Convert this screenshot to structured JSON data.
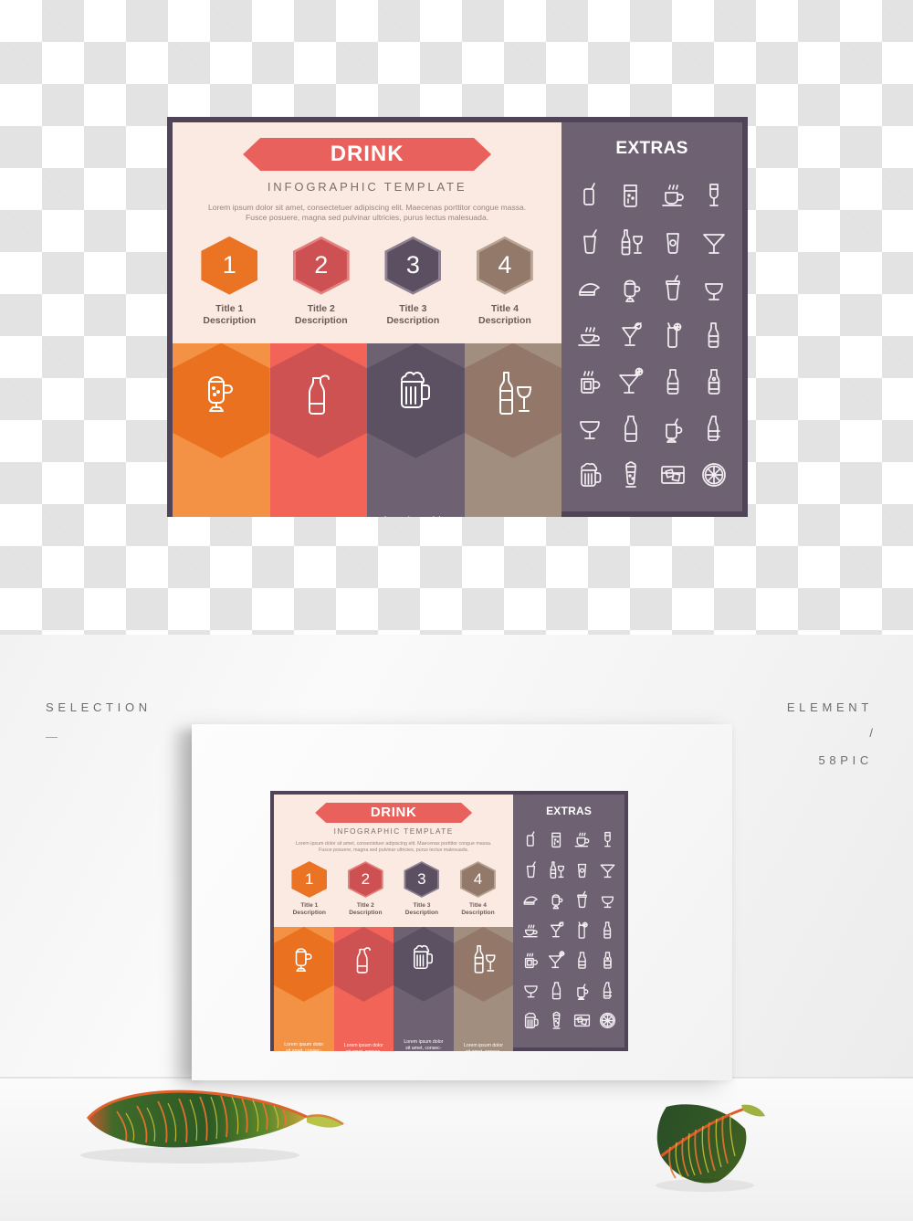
{
  "artwork": {
    "banner_title": "DRINK",
    "subtitle": "INFOGRAPHIC TEMPLATE",
    "lead": "Lorem ipsum dolor sit amet, consectetuer adipiscing elit. Maecenas porttitor congue massa. Fusce posuere, magna sed pulvinar ultricies, purus lectus malesuada.",
    "steps": [
      {
        "number": "1",
        "title": "Title 1",
        "description": "Description",
        "color": "#ea7324",
        "column_color": "#f39244",
        "hex_color": "#e9711f",
        "icon": "irish-coffee-mug-icon"
      },
      {
        "number": "2",
        "title": "Title 2",
        "description": "Description",
        "color": "#cd5152",
        "column_color": "#f26358",
        "hex_color": "#cf5253",
        "icon": "soda-bottle-straw-icon"
      },
      {
        "number": "3",
        "title": "Title 3",
        "description": "Description",
        "color": "#5b4f61",
        "column_color": "#6e6272",
        "hex_color": "#5c5063",
        "icon": "beer-mug-icon"
      },
      {
        "number": "4",
        "title": "Title 4",
        "description": "Description",
        "color": "#93796a",
        "column_color": "#a18e7e",
        "hex_color": "#93786a",
        "icon": "wine-bottle-glass-icon"
      }
    ],
    "column_text": "Lorem ipsum dolor sit amet, consec-tetuer adipiscing elit. Maecenas porttitor congue massa. Fusce posuere, magna.",
    "extras": {
      "title": "EXTRAS",
      "panel_color": "#6e6272",
      "icons": [
        "soda-can-straw-icon",
        "water-glass-icon",
        "coffee-cup-saucer-icon",
        "champagne-flute-icon",
        "takeaway-cup-straw-icon",
        "wine-bottle-glass-icon",
        "coffee-togo-cup-icon",
        "martini-glass-icon",
        "ice-cream-sundae-icon",
        "irish-coffee-mug-icon",
        "soda-cup-lid-straw-icon",
        "brandy-snifter-icon",
        "hot-tea-cup-icon",
        "cocktail-cherry-glass-icon",
        "highball-lemon-straw-icon",
        "beer-bottle-icon",
        "hot-coffee-mug-icon",
        "martini-olive-icon",
        "soda-bottle-icon",
        "wine-bottle-label-icon",
        "wine-glass-icon",
        "water-bottle-icon",
        "hot-drink-straw-mug-icon",
        "beer-bottle-slim-icon",
        "foamy-beer-mug-icon",
        "pilsner-glass-icon",
        "whiskey-ice-cubes-icon",
        "citrus-slice-icon"
      ]
    },
    "frame_color": "#504558",
    "background_color": "#faeae1"
  },
  "mockup": {
    "label_selection": "SELECTION",
    "label_dash": "—",
    "label_element": "ELEMENT",
    "label_slash": "/",
    "label_pic": "58PIC"
  }
}
